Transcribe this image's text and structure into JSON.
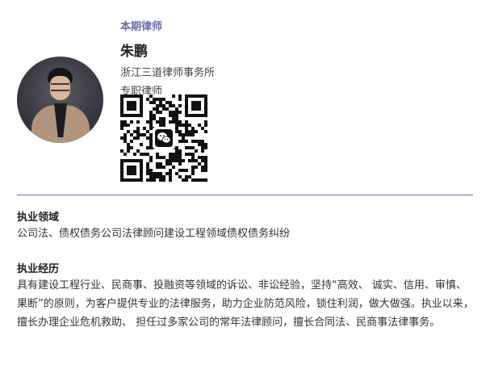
{
  "profile": {
    "kicker": "本期律师",
    "name": "朱鹏",
    "firm": "浙江三道律师事务所",
    "role": "专职律师",
    "avatar_icon": "lawyer-portrait",
    "qr_icon": "wechat-qr-code"
  },
  "practice_area": {
    "title": "执业领域",
    "text": "公司法、债权债务公司法律顾问建设工程领域债权债务纠纷"
  },
  "experience": {
    "title": "执业经历",
    "text": "具有建设工程行业、民商事、投融资等领域的诉讼、非讼经验，坚持“高效、 诚实、信用、审慎、果断”的原则，为客户提供专业的法律服务，助力企业防范风险，锁住利润，做大做强。执业以来，擅长办理企业危机救助、 担任过多家公司的常年法律顾问，擅长合同法、民商事法律事务。"
  },
  "colors": {
    "accent": "#6c6aa8",
    "text": "#333333"
  }
}
